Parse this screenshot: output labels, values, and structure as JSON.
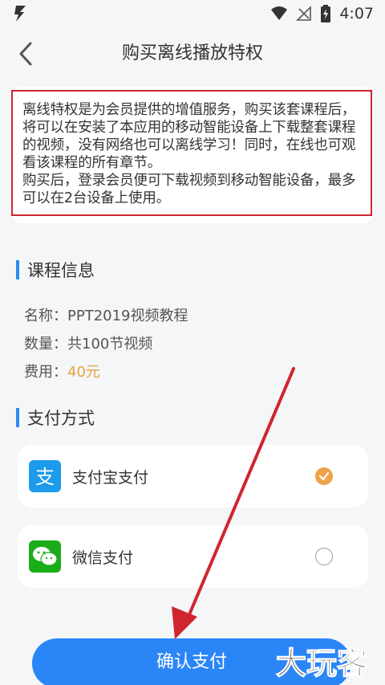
{
  "status_bar": {
    "time": "4:07",
    "icons": [
      "app-bolt-icon",
      "wifi-icon",
      "no-signal-icon",
      "battery-charging-icon"
    ]
  },
  "header": {
    "title": "购买离线播放特权",
    "back_icon": "chevron-left-icon"
  },
  "info_notice": {
    "paragraph1": "离线特权是为会员提供的增值服务，购买该套课程后，将可以在安装了本应用的移动智能设备上下载整套课程的视频，没有网络也可以离线学习！同时，在线也可观看该课程的所有章节。",
    "paragraph2": "购买后，登录会员便可下载视频到移动智能设备，最多可以在2台设备上使用。",
    "highlight_color": "#d0252e"
  },
  "course_info": {
    "section_title": "课程信息",
    "rows": [
      {
        "label": "名称：",
        "value": "PPT2019视频教程"
      },
      {
        "label": "数量：",
        "value": "共100节视频"
      },
      {
        "label": "费用：",
        "value": "40元"
      }
    ],
    "price_color": "#e6a23c"
  },
  "payment": {
    "section_title": "支付方式",
    "options": [
      {
        "label": "支付宝支付",
        "icon": "alipay-icon",
        "selected": true,
        "color": "#1c9aeb"
      },
      {
        "label": "微信支付",
        "icon": "wechat-pay-icon",
        "selected": false,
        "color": "#1aad19"
      }
    ]
  },
  "confirm_button": {
    "label": "确认支付",
    "color": "#2a86f7"
  },
  "accent_color": "#2a8cf0",
  "annotation": {
    "arrow_color": "#d0252e"
  },
  "watermark": {
    "text": "大玩客"
  }
}
